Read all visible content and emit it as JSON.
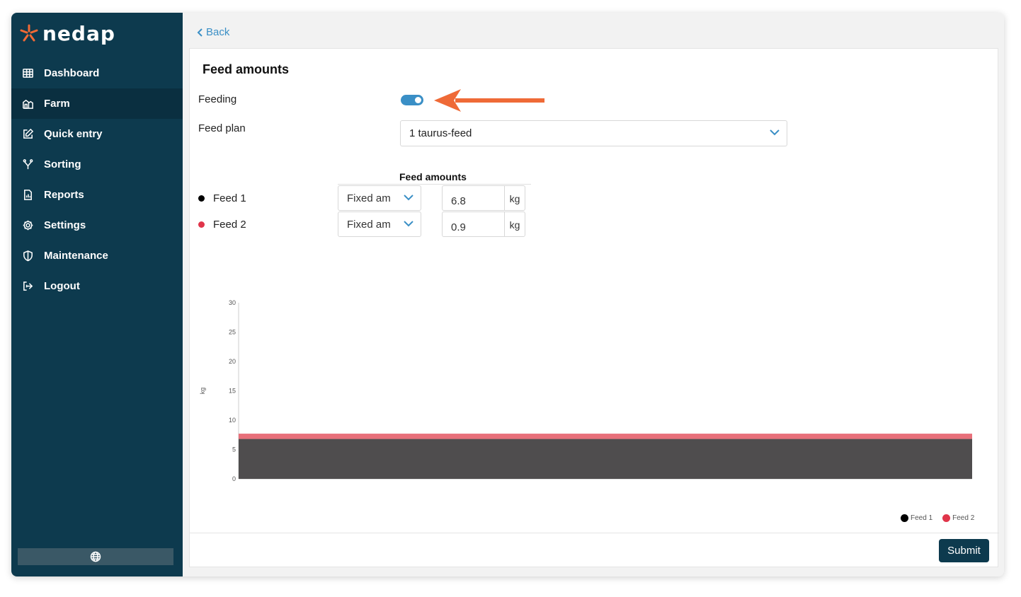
{
  "brand": {
    "name": "nedap",
    "star_color": "#f26a35"
  },
  "sidebar": {
    "items": [
      {
        "label": "Dashboard",
        "icon": "table-icon",
        "active": false
      },
      {
        "label": "Farm",
        "icon": "farm-icon",
        "active": true
      },
      {
        "label": "Quick entry",
        "icon": "edit-icon",
        "active": false
      },
      {
        "label": "Sorting",
        "icon": "sorting-icon",
        "active": false
      },
      {
        "label": "Reports",
        "icon": "report-icon",
        "active": false
      },
      {
        "label": "Settings",
        "icon": "gear-icon",
        "active": false
      },
      {
        "label": "Maintenance",
        "icon": "shield-icon",
        "active": false
      },
      {
        "label": "Logout",
        "icon": "logout-icon",
        "active": false
      }
    ],
    "language_icon": "globe-icon"
  },
  "header": {
    "back_label": "Back"
  },
  "form": {
    "title": "Feed amounts",
    "feeding_label": "Feeding",
    "feeding_enabled": true,
    "feed_plan_label": "Feed plan",
    "feed_plan_value": "1 taurus-feed",
    "amounts_header": "Feed amounts",
    "feeds": [
      {
        "name": "Feed 1",
        "mode": "Fixed am",
        "amount": "6.8",
        "unit": "kg",
        "color": "#000000"
      },
      {
        "name": "Feed 2",
        "mode": "Fixed am",
        "amount": "0.9",
        "unit": "kg",
        "color": "#e0354a"
      }
    ],
    "submit_label": "Submit"
  },
  "chart_data": {
    "type": "area",
    "stacked": true,
    "ylabel": "kg",
    "ylim": [
      0,
      30
    ],
    "yticks": [
      "0",
      "5",
      "10",
      "15",
      "20",
      "25",
      "30"
    ],
    "series": [
      {
        "name": "Feed 1",
        "value": 6.8,
        "color": "#4f4d4e"
      },
      {
        "name": "Feed 2",
        "value": 0.9,
        "color": "#e8707a"
      }
    ],
    "legend": [
      {
        "name": "Feed 1",
        "color": "#000000"
      },
      {
        "name": "Feed 2",
        "color": "#e0354a"
      }
    ]
  }
}
